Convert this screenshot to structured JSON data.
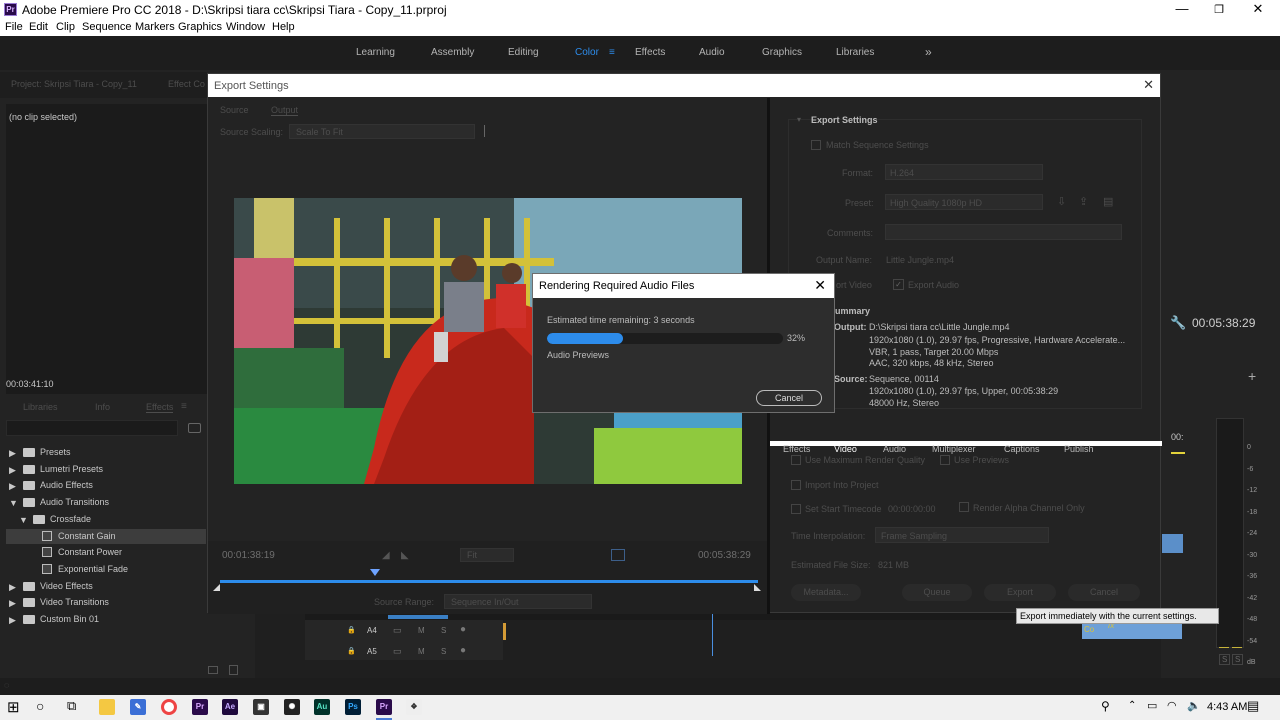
{
  "window": {
    "title": "Adobe Premiere Pro CC 2018 - D:\\Skripsi tiara cc\\Skripsi Tiara - Copy_11.prproj",
    "logo_text": "Pr",
    "controls": {
      "minimize": "—",
      "maximize": "❐",
      "close": "✕"
    }
  },
  "menu": [
    "File",
    "Edit",
    "Clip",
    "Sequence",
    "Markers",
    "Graphics",
    "Window",
    "Help"
  ],
  "workspaces": {
    "items": [
      "Learning",
      "Assembly",
      "Editing",
      "Color",
      "Effects",
      "Audio",
      "Graphics",
      "Libraries"
    ],
    "active": "Color",
    "more": "»",
    "menu_icon": "≡"
  },
  "project_panel": {
    "tab_project": "Project: Skripsi Tiara - Copy_11",
    "tab_effect": "Effect Co",
    "no_clip": "(no clip selected)",
    "timecode": "00:03:41:10"
  },
  "effects_panel": {
    "tabs": [
      "Libraries",
      "Info",
      "Effects"
    ],
    "menu_icon": "≡",
    "tree": [
      {
        "label": "Presets",
        "kind": "folder",
        "level": 0,
        "expanded": false
      },
      {
        "label": "Lumetri Presets",
        "kind": "folder",
        "level": 0,
        "expanded": false
      },
      {
        "label": "Audio Effects",
        "kind": "folder",
        "level": 0,
        "expanded": false
      },
      {
        "label": "Audio Transitions",
        "kind": "folder",
        "level": 0,
        "expanded": true
      },
      {
        "label": "Crossfade",
        "kind": "folder",
        "level": 1,
        "expanded": true
      },
      {
        "label": "Constant Gain",
        "kind": "item",
        "level": 2,
        "selected": true
      },
      {
        "label": "Constant Power",
        "kind": "item",
        "level": 2
      },
      {
        "label": "Exponential Fade",
        "kind": "item",
        "level": 2
      },
      {
        "label": "Video Effects",
        "kind": "folder",
        "level": 0,
        "expanded": false
      },
      {
        "label": "Video Transitions",
        "kind": "folder",
        "level": 0,
        "expanded": false
      },
      {
        "label": "Custom Bin 01",
        "kind": "folder",
        "level": 0,
        "expanded": false
      }
    ]
  },
  "program": {
    "timecode": "00:05:38:29"
  },
  "timeline": {
    "tracks": [
      "A4",
      "A5"
    ],
    "badge": "fx",
    "clip_label": "Co",
    "add_icon": "+"
  },
  "audio_meter": {
    "ticks": [
      "0",
      "-6",
      "-12",
      "-18",
      "-24",
      "-30",
      "-36",
      "-42",
      "-48",
      "-54",
      "dB"
    ],
    "solo": [
      "S",
      "S"
    ],
    "head_label": "00:"
  },
  "export_dialog": {
    "title": "Export Settings",
    "tabs": [
      "Source",
      "Output"
    ],
    "source_scaling_label": "Source Scaling:",
    "source_scaling_value": "Scale To Fit",
    "timecode_left": "00:01:38:19",
    "fit": "Fit",
    "timecode_right": "00:05:38:29",
    "playhead_percent": 28.8,
    "source_range_label": "Source Range:",
    "source_range_value": "Sequence In/Out",
    "settings": {
      "heading": "Export Settings",
      "match_sequence": "Match Sequence Settings",
      "format_label": "Format:",
      "format_value": "H.264",
      "preset_label": "Preset:",
      "preset_value": "High Quality 1080p HD",
      "comments_label": "Comments:",
      "output_name_label": "Output Name:",
      "output_name_value": "Little Jungle.mp4",
      "export_video": "Export Video",
      "export_video_visible": "ort Video",
      "export_audio": "Export Audio",
      "summary_heading": "ummary",
      "output_label": "Output:",
      "output_lines": [
        "D:\\Skripsi tiara cc\\Little Jungle.mp4",
        "1920x1080 (1.0), 29.97 fps, Progressive, Hardware Accelerate...",
        "VBR, 1 pass, Target 20.00 Mbps",
        "AAC, 320 kbps, 48 kHz, Stereo"
      ],
      "source_label": "Source:",
      "source_lines": [
        "Sequence, 00114",
        "1920x1080 (1.0), 29.97 fps, Upper, 00:05:38:29",
        "48000 Hz, Stereo"
      ],
      "tabs": [
        "Effects",
        "Video",
        "Audio",
        "Multiplexer",
        "Captions",
        "Publish"
      ],
      "active_tab": "Video",
      "use_max_render": "Use Maximum Render Quality",
      "use_previews": "Use Previews",
      "import_into_project": "Import Into Project",
      "set_start_timecode": "Set Start Timecode",
      "start_timecode_value": "00:00:00:00",
      "render_alpha": "Render Alpha Channel Only",
      "time_interp_label": "Time Interpolation:",
      "time_interp_value": "Frame Sampling",
      "file_size_label": "Estimated File Size:",
      "file_size_value": "821 MB",
      "metadata_button": "Metadata...",
      "queue_button": "Queue",
      "export_button": "Export",
      "cancel_button": "Cancel"
    }
  },
  "tooltip": "Export immediately with the current settings.",
  "render_modal": {
    "title": "Rendering Required Audio Files",
    "estimated": "Estimated time remaining: 3 seconds",
    "progress_percent": 32,
    "progress_text": "32%",
    "status": "Audio Previews",
    "cancel_button": "Cancel",
    "progress_color": "#2d8ceb"
  },
  "taskbar": {
    "time": "4:43 AM",
    "apps": [
      {
        "name": "premiere-icon",
        "text": "Pr",
        "bg": "#2a0b4a",
        "fg": "#d9a8ff"
      },
      {
        "name": "after-effects-icon",
        "text": "Ae",
        "bg": "#1f0a3d",
        "fg": "#c4a8ff"
      },
      {
        "name": "audition-icon",
        "text": "Au",
        "bg": "#00322a",
        "fg": "#55e2c3"
      },
      {
        "name": "photoshop-icon",
        "text": "Ps",
        "bg": "#001e36",
        "fg": "#31a8ff"
      },
      {
        "name": "premiere-active-icon",
        "text": "Pr",
        "bg": "#2a0b4a",
        "fg": "#d9a8ff"
      }
    ]
  },
  "colors": {
    "accent": "#2d8ceb",
    "playhead": "#6ea3ff",
    "timeline_clip": "#3a7fc4",
    "yellow_marker": "#e3d23b"
  }
}
